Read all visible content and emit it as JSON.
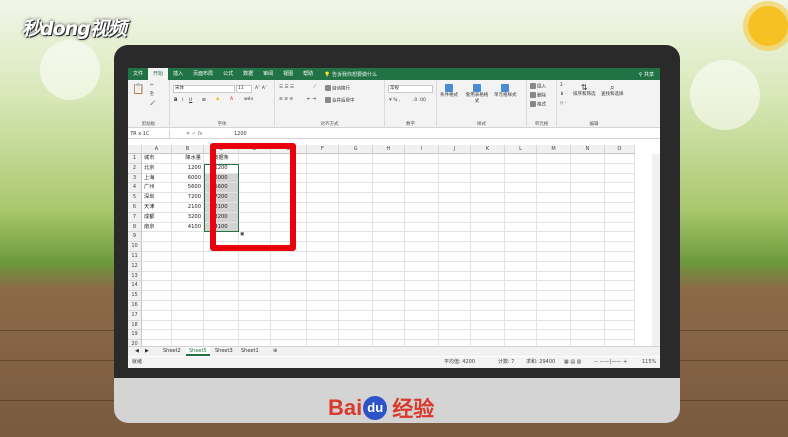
{
  "watermark_logo": "秒dong视频",
  "baidu_brand": {
    "part1": "Bai",
    "part2": "du",
    "part3": "经验"
  },
  "menu": {
    "tabs": [
      "文件",
      "开始",
      "插入",
      "页面布局",
      "公式",
      "数据",
      "审阅",
      "视图",
      "帮助"
    ],
    "active_index": 1,
    "tell_me": "告诉我你想要做什么",
    "share": "共享"
  },
  "ribbon": {
    "font_name": "宋体",
    "font_size": "11",
    "number_format": "常规",
    "wrap_text": "自动换行",
    "merge_center": "合并后居中",
    "conditional_format": "条件格式",
    "table_format": "套用表格格式",
    "cell_style": "单元格样式",
    "insert": "插入",
    "delete": "删除",
    "format": "格式",
    "sort_filter": "排序和筛选",
    "find_select": "查找和选择",
    "groups": [
      "剪贴板",
      "字体",
      "对齐方式",
      "数字",
      "样式",
      "单元格",
      "编辑"
    ]
  },
  "formula_bar": {
    "name_box": "7R x 1C",
    "fx": "fx",
    "value": "1200"
  },
  "columns": [
    "A",
    "B",
    "C",
    "D",
    "E",
    "F",
    "G",
    "H",
    "I",
    "J",
    "K",
    "L",
    "M",
    "N",
    "O"
  ],
  "row_numbers": [
    "1",
    "2",
    "3",
    "4",
    "5",
    "6",
    "7",
    "8",
    "9",
    "10",
    "11",
    "12",
    "13",
    "14",
    "15",
    "16",
    "17",
    "18",
    "19",
    "20"
  ],
  "table": {
    "headers": [
      "城市",
      "降水量",
      "数据条"
    ],
    "rows": [
      [
        "北京",
        "1200",
        "1200"
      ],
      [
        "上海",
        "6000",
        "6000"
      ],
      [
        "广州",
        "5600",
        "5600"
      ],
      [
        "深圳",
        "7200",
        "7200"
      ],
      [
        "天津",
        "2100",
        "2100"
      ],
      [
        "成都",
        "3200",
        "3200"
      ],
      [
        "南京",
        "4100",
        "4100"
      ]
    ]
  },
  "sheets": [
    "Sheet2",
    "Sheet5",
    "Sheet3",
    "Sheet1"
  ],
  "active_sheet_index": 1,
  "status": {
    "ready": "就绪",
    "average": "平均值: 4200",
    "count": "计数: 7",
    "sum": "求和: 29400",
    "zoom": "115%"
  }
}
